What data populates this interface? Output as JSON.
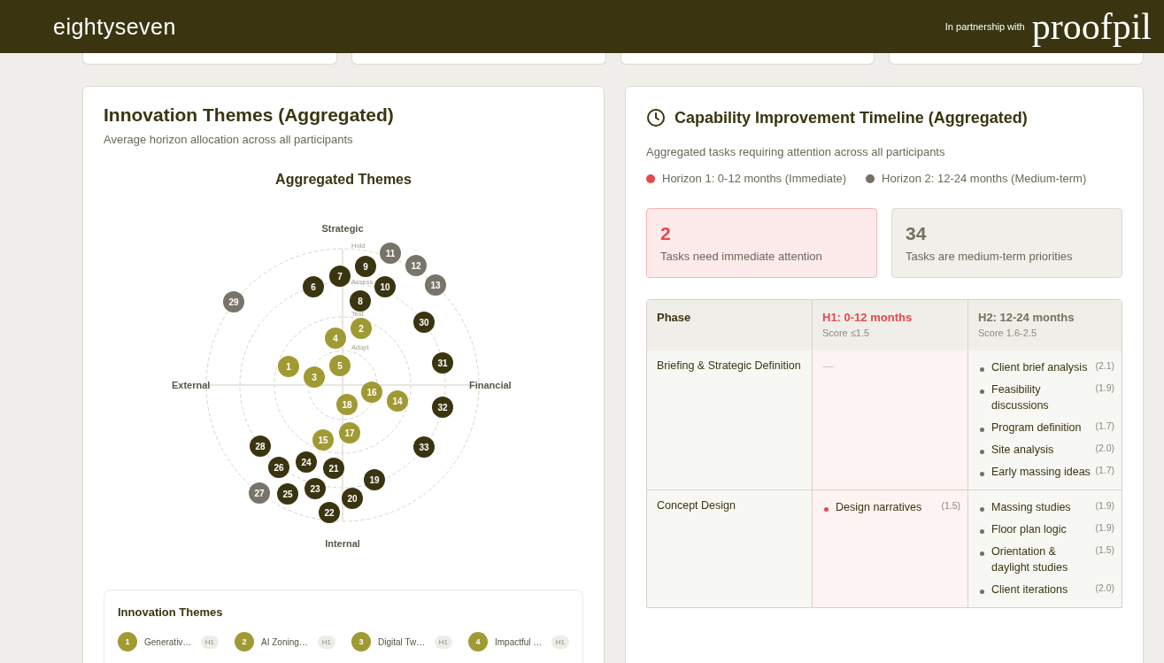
{
  "header": {
    "logo": "eightyseven",
    "partner_label": "In partnership with",
    "partner_logo": "proofpil"
  },
  "summary_cards": [
    {
      "kind": "card"
    },
    {
      "kind": "card"
    },
    {
      "kind": "card"
    },
    {
      "kind": "card"
    }
  ],
  "themes_panel": {
    "title": "Innovation Themes (Aggregated)",
    "subtitle": "Average horizon allocation across all participants",
    "chart_title": "Aggregated Themes",
    "axes": {
      "top": "Strategic",
      "right": "Financial",
      "bottom": "Internal",
      "left": "External"
    },
    "rings": [
      "Hold",
      "Assess",
      "Test",
      "Adopt"
    ],
    "dots": [
      {
        "label": "1",
        "color": "#a09a35"
      },
      {
        "label": "2",
        "color": "#a09a35"
      },
      {
        "label": "3",
        "color": "#a09a35"
      },
      {
        "label": "4",
        "color": "#a09a35"
      },
      {
        "label": "5",
        "color": "#a09a35"
      },
      {
        "label": "6",
        "color": "#3a3510"
      },
      {
        "label": "7",
        "color": "#3a3510"
      },
      {
        "label": "8",
        "color": "#3a3510"
      },
      {
        "label": "9",
        "color": "#3a3510"
      },
      {
        "label": "10",
        "color": "#3a3510"
      },
      {
        "label": "11",
        "color": "#78746a"
      },
      {
        "label": "12",
        "color": "#78746a"
      },
      {
        "label": "13",
        "color": "#78746a"
      },
      {
        "label": "14",
        "color": "#a09a35"
      },
      {
        "label": "15",
        "color": "#a09a35"
      },
      {
        "label": "16",
        "color": "#a09a35"
      },
      {
        "label": "18",
        "color": "#a09a35"
      },
      {
        "label": "17",
        "color": "#a09a35"
      },
      {
        "label": "19",
        "color": "#3a3510"
      },
      {
        "label": "20",
        "color": "#3a3510"
      },
      {
        "label": "21",
        "color": "#3a3510"
      },
      {
        "label": "22",
        "color": "#3a3510"
      },
      {
        "label": "23",
        "color": "#3a3510"
      },
      {
        "label": "24",
        "color": "#3a3510"
      },
      {
        "label": "25",
        "color": "#3a3510"
      },
      {
        "label": "26",
        "color": "#3a3510"
      },
      {
        "label": "27",
        "color": "#78746a"
      },
      {
        "label": "28",
        "color": "#3a3510"
      },
      {
        "label": "29",
        "color": "#78746a"
      },
      {
        "label": "30",
        "color": "#3a3510"
      },
      {
        "label": "31",
        "color": "#3a3510"
      },
      {
        "label": "32",
        "color": "#3a3510"
      },
      {
        "label": "33",
        "color": "#3a3510"
      }
    ],
    "legend": {
      "title": "Innovation Themes",
      "items": [
        {
          "number": "1",
          "name": "Generativ…",
          "horizon": "H1",
          "color": "#a09a35"
        },
        {
          "number": "2",
          "name": "AI Zoning…",
          "horizon": "H1",
          "color": "#a09a35"
        },
        {
          "number": "3",
          "name": "Digital Tw…",
          "horizon": "H1",
          "color": "#a09a35"
        },
        {
          "number": "4",
          "name": "Impactful …",
          "horizon": "H1",
          "color": "#a09a35"
        }
      ]
    }
  },
  "timeline_panel": {
    "title": "Capability Improvement Timeline (Aggregated)",
    "subtitle": "Aggregated tasks requiring attention across all participants",
    "legend": [
      {
        "label": "Horizon 1: 0-12 months (Immediate)",
        "color": "#e5484d"
      },
      {
        "label": "Horizon 2: 12-24 months (Medium-term)",
        "color": "#75705f"
      }
    ],
    "stats": [
      {
        "kind": "h1",
        "value": "2",
        "label": "Tasks need immediate attention"
      },
      {
        "kind": "h2",
        "value": "34",
        "label": "Tasks are medium-term priorities"
      }
    ],
    "table": {
      "columns": [
        {
          "kind": "phase",
          "title": "Phase"
        },
        {
          "kind": "h1",
          "title": "H1: 0-12 months",
          "note": "Score ≤1.5"
        },
        {
          "kind": "h2",
          "title": "H2: 12-24 months",
          "note": "Score 1.6-2.5"
        }
      ],
      "rows": [
        {
          "phase": "Briefing & Strategic Definition",
          "h1": [],
          "h1_empty": "—",
          "h2": [
            {
              "task": "Client brief analysis",
              "score": "(2.1)"
            },
            {
              "task": "Feasibility discussions",
              "score": "(1.9)"
            },
            {
              "task": "Program definition",
              "score": "(1.7)"
            },
            {
              "task": "Site analysis",
              "score": "(2.0)"
            },
            {
              "task": "Early massing ideas",
              "score": "(1.7)"
            }
          ]
        },
        {
          "phase": "Concept Design",
          "h1": [
            {
              "task": "Design narratives",
              "score": "(1.5)"
            }
          ],
          "h2": [
            {
              "task": "Massing studies",
              "score": "(1.9)"
            },
            {
              "task": "Floor plan logic",
              "score": "(1.9)"
            },
            {
              "task": "Orientation & daylight studies",
              "score": "(1.5)"
            },
            {
              "task": "Client iterations",
              "score": "(2.0)"
            }
          ]
        }
      ]
    }
  }
}
